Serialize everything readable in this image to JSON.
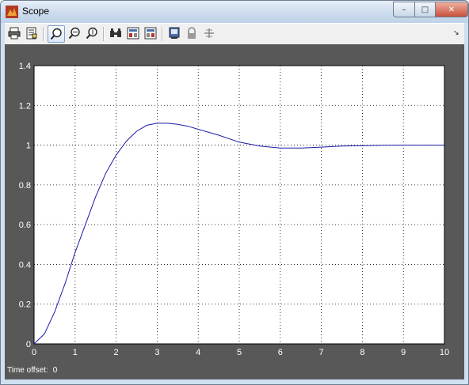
{
  "window": {
    "title": "Scope",
    "minimize": "–",
    "maximize": "□",
    "close": "✕"
  },
  "toolbar": {
    "icons": [
      "print-icon",
      "parameters-icon",
      "zoom-icon",
      "zoom-x-icon",
      "zoom-y-icon",
      "autoscale-icon",
      "save-axes-icon",
      "restore-axes-icon",
      "floating-scope-icon",
      "lock-axes-icon",
      "signal-selector-icon"
    ],
    "menu": "↘"
  },
  "status": {
    "label": "Time offset:",
    "value": "0"
  },
  "colors": {
    "plot_bg": "#ffffff",
    "axes_bg": "#585858",
    "line": "#1a1aa8",
    "grid": "#000000"
  },
  "chart_data": {
    "type": "line",
    "title": "",
    "xlabel": "",
    "ylabel": "",
    "xlim": [
      0,
      10
    ],
    "ylim": [
      0,
      1.4
    ],
    "xticks": [
      "0",
      "1",
      "2",
      "3",
      "4",
      "5",
      "6",
      "7",
      "8",
      "9",
      "10"
    ],
    "yticks": [
      "0",
      "0.2",
      "0.4",
      "0.6",
      "0.8",
      "1",
      "1.2",
      "1.4"
    ],
    "grid": true,
    "series": [
      {
        "x": [
          0,
          0.25,
          0.5,
          0.75,
          1,
          1.25,
          1.5,
          1.75,
          2,
          2.25,
          2.5,
          2.75,
          3,
          3.25,
          3.5,
          3.75,
          4,
          4.5,
          5,
          5.5,
          6,
          6.5,
          7,
          7.5,
          8,
          8.5,
          9,
          9.5,
          10
        ],
        "y": [
          0,
          0.05,
          0.16,
          0.3,
          0.46,
          0.6,
          0.74,
          0.86,
          0.95,
          1.02,
          1.07,
          1.1,
          1.11,
          1.11,
          1.105,
          1.095,
          1.08,
          1.05,
          1.015,
          0.995,
          0.985,
          0.985,
          0.99,
          0.995,
          0.997,
          0.999,
          1.0,
          1.0,
          1.0
        ]
      }
    ]
  }
}
